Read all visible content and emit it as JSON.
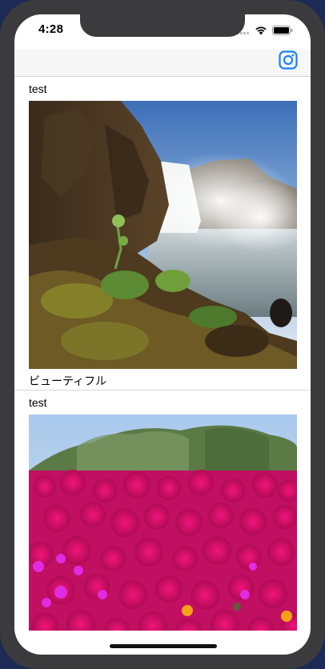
{
  "status_bar": {
    "time": "4:28",
    "icons": [
      "cellular-signal-icon",
      "wifi-icon",
      "battery-icon"
    ]
  },
  "nav_bar": {
    "icons": [
      "camera-icon"
    ],
    "accent_color": "#1a82f7"
  },
  "feed": {
    "posts": [
      {
        "user": "test",
        "photo": "waterfall-photo",
        "caption": "ビューティフル"
      },
      {
        "user": "test",
        "photo": "flowers-photo",
        "caption": ""
      }
    ]
  }
}
